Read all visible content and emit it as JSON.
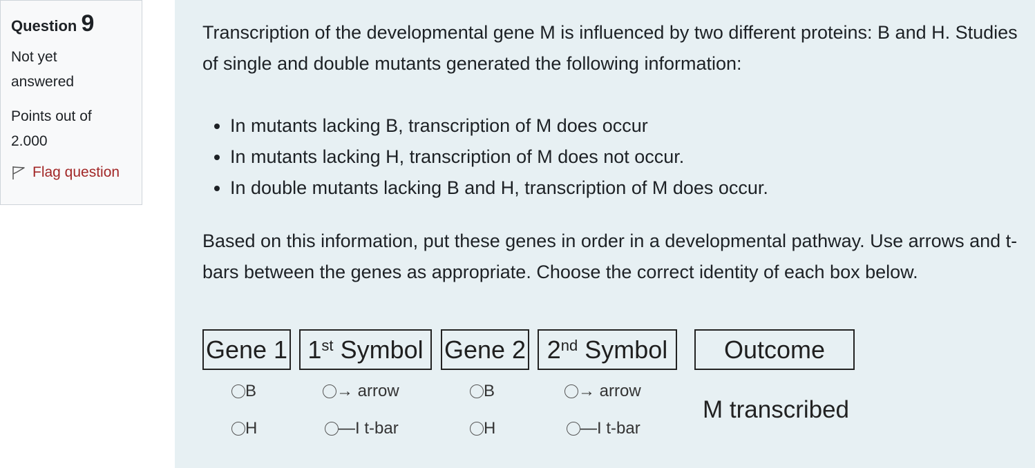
{
  "info": {
    "question_label": "Question",
    "question_number": "9",
    "state_line1": "Not yet",
    "state_line2": "answered",
    "grade_line1": "Points out of",
    "grade_line2": "2.000",
    "flag_label": "Flag question",
    "flag_icon": "flag-outline-icon"
  },
  "question": {
    "intro": "Transcription of the developmental gene M is influenced by two different proteins: B and H. Studies of single and double mutants generated the following information:",
    "bullets": [
      "In mutants lacking B, transcription of M does occur",
      "In mutants lacking H, transcription of M does not occur.",
      "In double mutants lacking B and H, transcription of M does occur."
    ],
    "instruction": "Based on this information, put these genes in order in a developmental pathway. Use arrows and t-bars between the genes as appropriate. Choose the correct identity of each box below."
  },
  "grid": {
    "headers": {
      "gene1": "Gene 1",
      "sym1_num": "1",
      "sym1_sup": "st",
      "sym1_word": "Symbol",
      "gene2": "Gene 2",
      "sym2_num": "2",
      "sym2_sup": "nd",
      "sym2_word": "Symbol",
      "outcome": "Outcome"
    },
    "gene1_options": [
      "B",
      "H"
    ],
    "symbol1_options": [
      "→ arrow",
      "—I t-bar"
    ],
    "gene2_options": [
      "B",
      "H"
    ],
    "symbol2_options": [
      "→ arrow",
      "—I t-bar"
    ],
    "outcome_value": "M transcribed"
  },
  "colors": {
    "content_bg": "#e7f0f3",
    "info_bg": "#f8f9fa",
    "flag_text": "#a22727"
  }
}
